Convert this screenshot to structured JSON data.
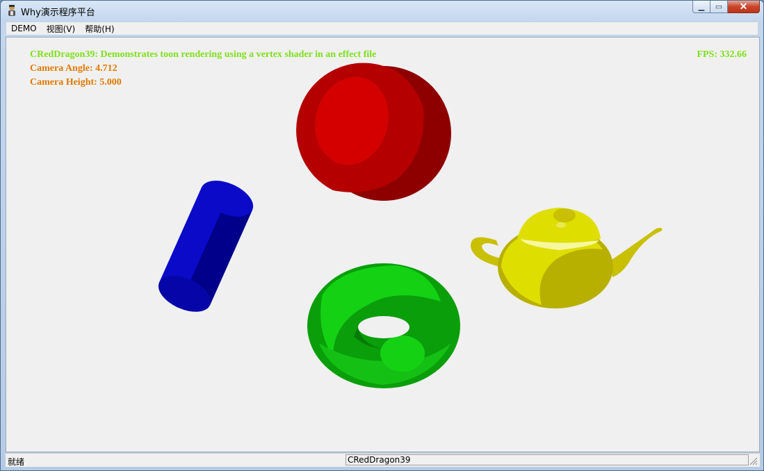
{
  "window": {
    "title": "Why演示程序平台"
  },
  "caption_buttons": {
    "minimize": "▁",
    "maximize": "▭",
    "close": "✕"
  },
  "menu": {
    "items": [
      "DEMO",
      "视图(V)",
      "帮助(H)"
    ]
  },
  "hud": {
    "description": "CRedDragon39: Demonstrates toon rendering using a vertex shader in an effect file",
    "camera_angle": "Camera Angle: 4.712",
    "camera_height": "Camera Height: 5.000",
    "fps": "FPS: 332.66"
  },
  "scene": {
    "objects": [
      {
        "name": "sphere",
        "color": "#d40000"
      },
      {
        "name": "cylinder",
        "color": "#0a0ac8"
      },
      {
        "name": "torus",
        "color": "#14d114"
      },
      {
        "name": "teapot",
        "color": "#dede00"
      }
    ]
  },
  "status": {
    "left": "就绪",
    "right": "CRedDragon39"
  }
}
